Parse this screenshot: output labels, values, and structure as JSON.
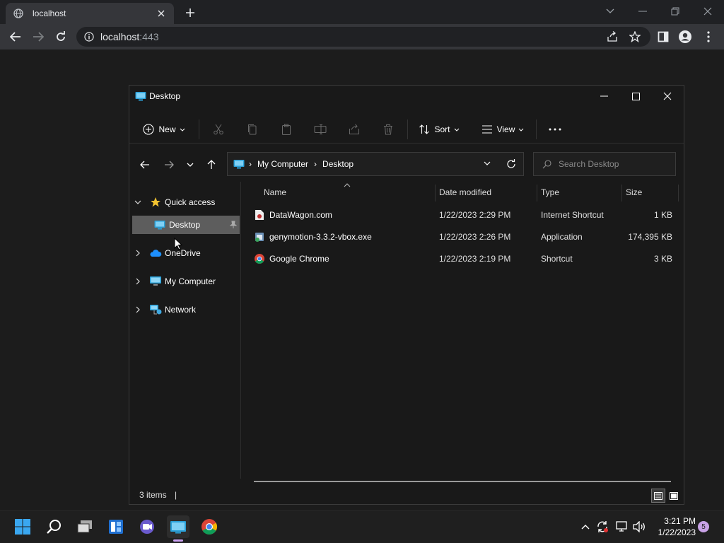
{
  "browser": {
    "tab_title": "localhost",
    "url_host": "localhost",
    "url_port": ":443"
  },
  "explorer": {
    "title": "Desktop",
    "toolbar": {
      "new_label": "New",
      "sort_label": "Sort",
      "view_label": "View"
    },
    "breadcrumb": [
      "My Computer",
      "Desktop"
    ],
    "search_placeholder": "Search Desktop",
    "nav": {
      "quick_access": "Quick access",
      "desktop": "Desktop",
      "onedrive": "OneDrive",
      "my_computer": "My Computer",
      "network": "Network"
    },
    "columns": {
      "name": "Name",
      "date": "Date modified",
      "type": "Type",
      "size": "Size"
    },
    "files": [
      {
        "name": "DataWagon.com",
        "date": "1/22/2023 2:29 PM",
        "type": "Internet Shortcut",
        "size": "1 KB"
      },
      {
        "name": "genymotion-3.3.2-vbox.exe",
        "date": "1/22/2023 2:26 PM",
        "type": "Application",
        "size": "174,395 KB"
      },
      {
        "name": "Google Chrome",
        "date": "1/22/2023 2:19 PM",
        "type": "Shortcut",
        "size": "3 KB"
      }
    ],
    "status": "3 items"
  },
  "taskbar": {
    "time": "3:21 PM",
    "date": "1/22/2023",
    "notification_count": "5"
  }
}
